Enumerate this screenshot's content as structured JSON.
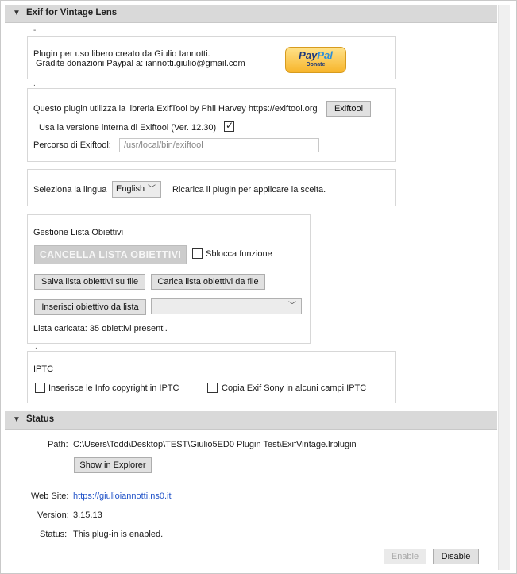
{
  "exif_section": {
    "title": "Exif for Vintage Lens",
    "info": {
      "line1": "Plugin per uso libero creato da Giulio Iannotti.",
      "line2": "Gradite donazioni Paypal a: iannotti.giulio@gmail.com",
      "paypal_text_a": "Pay",
      "paypal_text_b": "Pal",
      "paypal_sub": "Donate"
    },
    "exiftool": {
      "description": "Questo plugin utilizza la libreria ExifTool by Phil Harvey https://exiftool.org",
      "button_label": "Exiftool",
      "internal_label": "Usa la versione interna di Exiftool  (Ver. 12.30)",
      "internal_checked": true,
      "path_label": "Percorso di Exiftool:",
      "path_value": "/usr/local/bin/exiftool"
    },
    "language": {
      "label": "Seleziona la lingua",
      "selected": "English",
      "note": "Ricarica il plugin per applicare la scelta."
    },
    "lens_list": {
      "title": "Gestione Lista Obiettivi",
      "clear_button": "CANCELLA LISTA OBIETTIVI",
      "unlock_label": "Sblocca funzione",
      "save_button": "Salva lista obiettivi su file",
      "load_button": "Carica lista obiettivi da file",
      "insert_button": "Inserisci obiettivo da lista",
      "dropdown_value": "",
      "status": "Lista caricata: 35 obiettivi presenti."
    },
    "iptc": {
      "title": "IPTC",
      "copyright_label": "Inserisce le Info copyright in IPTC",
      "sony_label": "Copia Exif Sony in alcuni campi IPTC"
    }
  },
  "status_section": {
    "title": "Status",
    "path_label": "Path:",
    "path_value": "C:\\Users\\Todd\\Desktop\\TEST\\Giulio5ED0 Plugin Test\\ExifVintage.lrplugin",
    "show_button": "Show in Explorer",
    "website_label": "Web Site:",
    "website_value": "https://giulioiannotti.ns0.it",
    "version_label": "Version:",
    "version_value": "3.15.13",
    "status_label": "Status:",
    "status_value": "This plug-in is enabled.",
    "enable_button": "Enable",
    "disable_button": "Disable"
  },
  "icons": {
    "collapse": "triangle-down-icon",
    "checkmark": "checkmark-icon",
    "chevron": "chevron-down-icon"
  }
}
